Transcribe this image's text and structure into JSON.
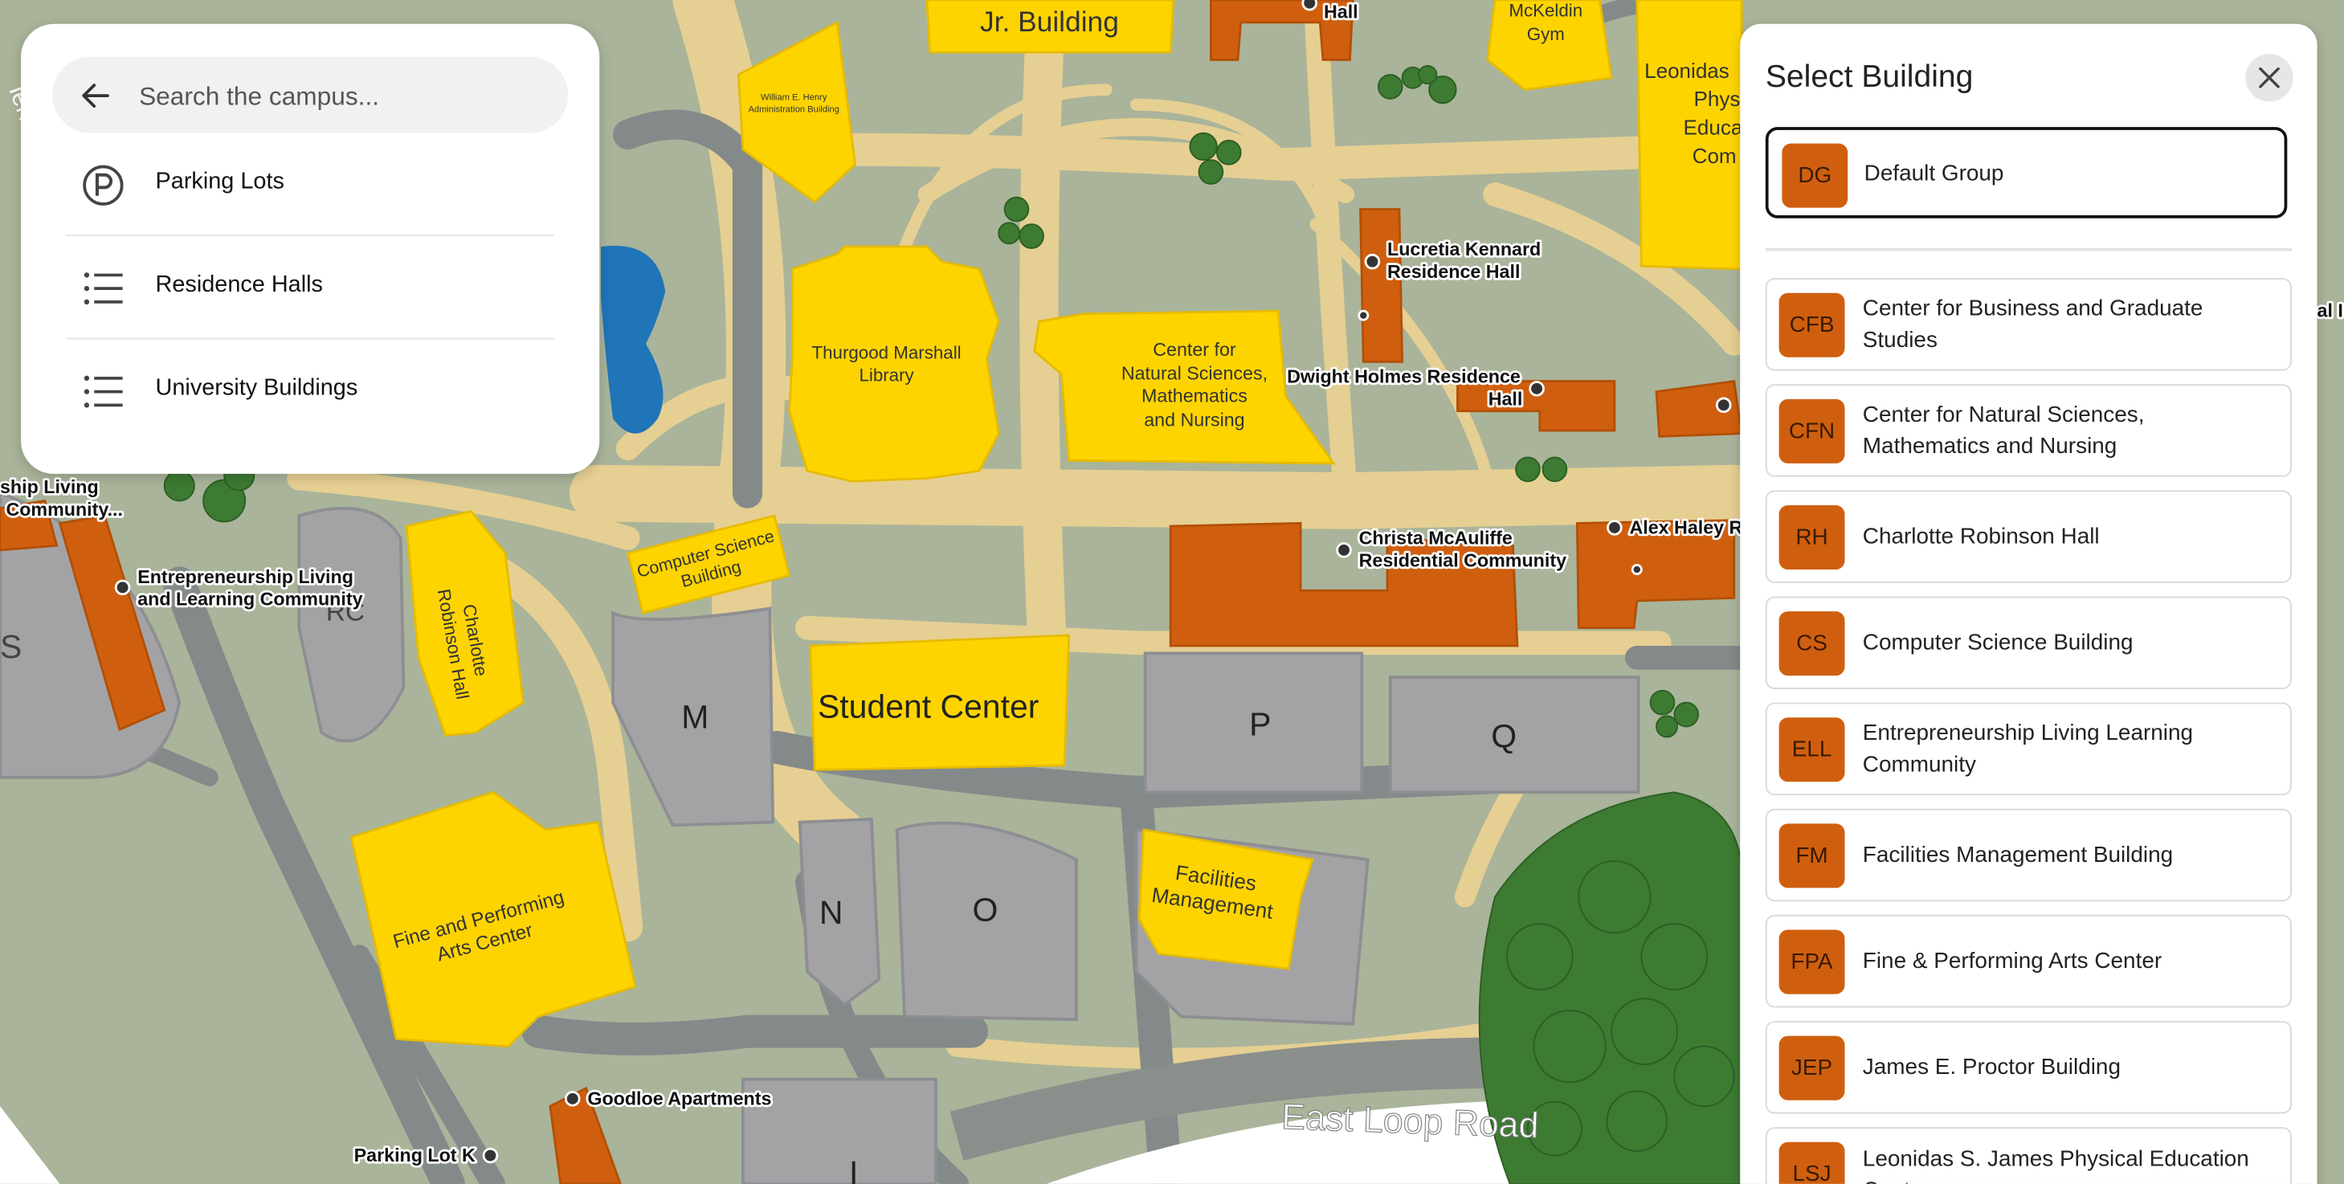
{
  "search": {
    "placeholder": "Search the campus...",
    "menu": [
      {
        "label": "Parking Lots",
        "icon": "parking-icon"
      },
      {
        "label": "Residence Halls",
        "icon": "list-icon"
      },
      {
        "label": "University Buildings",
        "icon": "list-icon"
      }
    ]
  },
  "building_panel": {
    "title": "Select Building",
    "default_group": {
      "abbr": "DG",
      "name": "Default Group"
    },
    "buildings": [
      {
        "abbr": "CFB",
        "name": "Center for Business and Graduate Studies"
      },
      {
        "abbr": "CFN",
        "name": "Center for Natural Sciences, Mathematics and Nursing"
      },
      {
        "abbr": "RH",
        "name": "Charlotte Robinson Hall"
      },
      {
        "abbr": "CS",
        "name": "Computer Science Building"
      },
      {
        "abbr": "ELL",
        "name": "Entrepreneurship Living Learning Community"
      },
      {
        "abbr": "FM",
        "name": "Facilities Management Building"
      },
      {
        "abbr": "FPA",
        "name": "Fine & Performing Arts Center"
      },
      {
        "abbr": "JEP",
        "name": "James E. Proctor Building"
      },
      {
        "abbr": "LSJ",
        "name": "Leonidas S. James Physical Education Center"
      }
    ]
  },
  "map": {
    "building_labels": {
      "jr_building": "Jr. Building",
      "hall_top": "Hall",
      "mckeldin_1": "McKeldin",
      "mckeldin_2": "Gym",
      "leonidas_1": "Leonidas",
      "leonidas_2": "Phys",
      "leonidas_3": "Educa",
      "leonidas_4": "Com",
      "henry_1": "William E. Henry",
      "henry_2": "Administration Building",
      "library_1": "Thurgood Marshall",
      "library_2": "Library",
      "cnsm_1": "Center for",
      "cnsm_2": "Natural Sciences,",
      "cnsm_3": "Mathematics",
      "cnsm_4": "and Nursing",
      "cs_1": "Computer Science",
      "cs_2": "Building",
      "robinson_1": "Charlotte",
      "robinson_2": "Robinson Hall",
      "student_center": "Student Center",
      "fpa_1": "Fine and Performing",
      "fpa_2": "Arts Center",
      "facilities_1": "Facilities",
      "facilities_2": "Management",
      "rc": "RC",
      "s": "S"
    },
    "lots": {
      "m": "M",
      "n": "N",
      "o": "O",
      "p": "P",
      "q": "Q",
      "i": "I"
    },
    "poi": {
      "kennard_1": "Lucretia Kennard",
      "kennard_2": "Residence Hall",
      "holmes_1": "Dwight Holmes Residence",
      "holmes_2": "Hall",
      "mcauliffe_1": "Christa McAuliffe",
      "mcauliffe_2": "Residential Community",
      "haley": "Alex Haley R",
      "ell_1": "Entrepreneurship Living",
      "ell_2": "and Learning Community",
      "ship_1": "ship Living",
      "ship_2": "Community...",
      "goodloe": "Goodloe Apartments",
      "lot_k": "Parking Lot K"
    },
    "road": "East Loop Road",
    "road_edge": "ierfic",
    "edge_label": "al I"
  },
  "colors": {
    "university_building": "#fed400",
    "residence_hall": "#cf5f0f",
    "parking": "#a3a3a6",
    "ground": "#a9b49a",
    "paths": "#e8cf90",
    "water": "#1f75b8",
    "trees": "#3d7a32"
  }
}
